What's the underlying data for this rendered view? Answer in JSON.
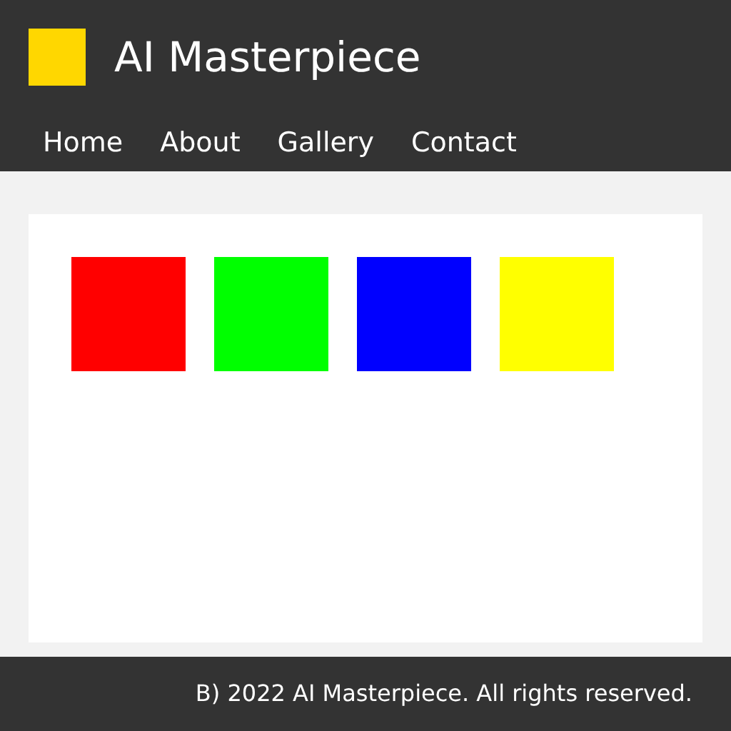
{
  "header": {
    "title": "AI Masterpiece"
  },
  "nav": [
    {
      "label": "Home"
    },
    {
      "label": "About"
    },
    {
      "label": "Gallery"
    },
    {
      "label": "Contact"
    }
  ],
  "gallery": [
    {
      "color": "#ff0000"
    },
    {
      "color": "#00ff00"
    },
    {
      "color": "#0000ff"
    },
    {
      "color": "#ffff00"
    }
  ],
  "footer": {
    "text": "B) 2022 AI Masterpiece. All rights reserved."
  }
}
